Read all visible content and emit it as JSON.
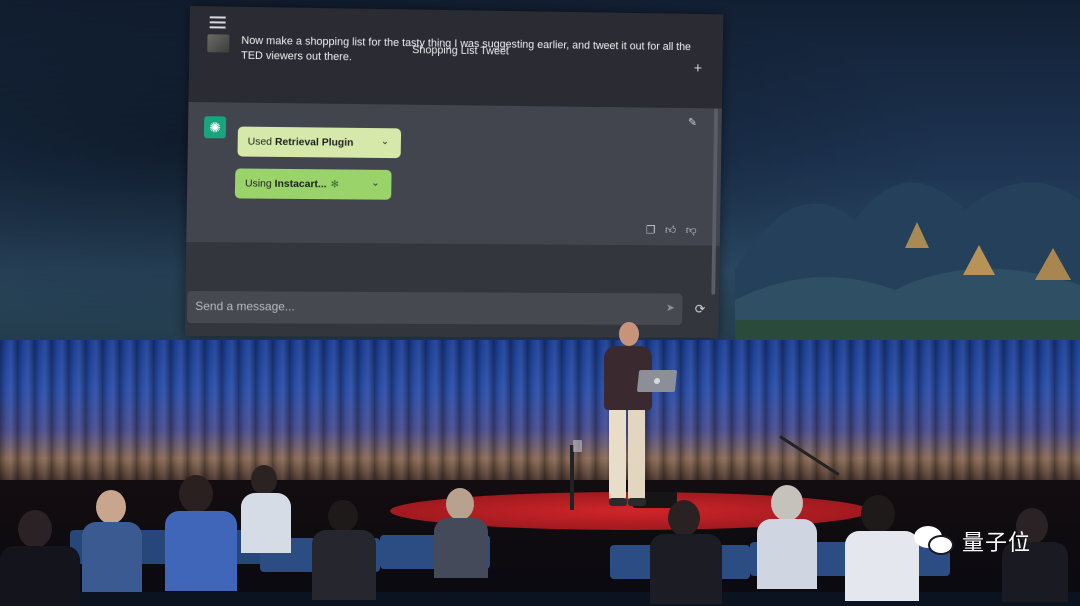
{
  "chat": {
    "title": "Shopping List Tweet",
    "user_message": "Now make a shopping list for the tasty thing I was suggesting earlier, and tweet it out for all the TED viewers out there.",
    "plugins": [
      {
        "prefix": "Used",
        "name": "Retrieval Plugin",
        "suffix": ""
      },
      {
        "prefix": "Using",
        "name": "Instacart...",
        "suffix": ""
      }
    ],
    "input_placeholder": "Send a message..."
  },
  "icons": {
    "menu": "menu-icon",
    "new_chat": "plus-icon",
    "edit": "edit-icon",
    "copy": "copy-icon",
    "thumbs_up": "thumbs-up-icon",
    "thumbs_down": "thumbs-down-icon",
    "send": "send-icon",
    "regenerate": "regenerate-icon",
    "assistant_avatar": "openai-logo-icon",
    "pill_chevron": "chevron-down-icon",
    "spinner": "spinner-icon"
  },
  "colors": {
    "chat_background": "#34363e",
    "assistant_background": "#43454e",
    "pill_used": "#d6e9ab",
    "pill_using": "#9bd36b",
    "assistant_avatar": "#19a37e",
    "stage_circle": "#d0252a",
    "curtain": "#2b4ea8"
  },
  "watermark": {
    "text": "量子位"
  }
}
